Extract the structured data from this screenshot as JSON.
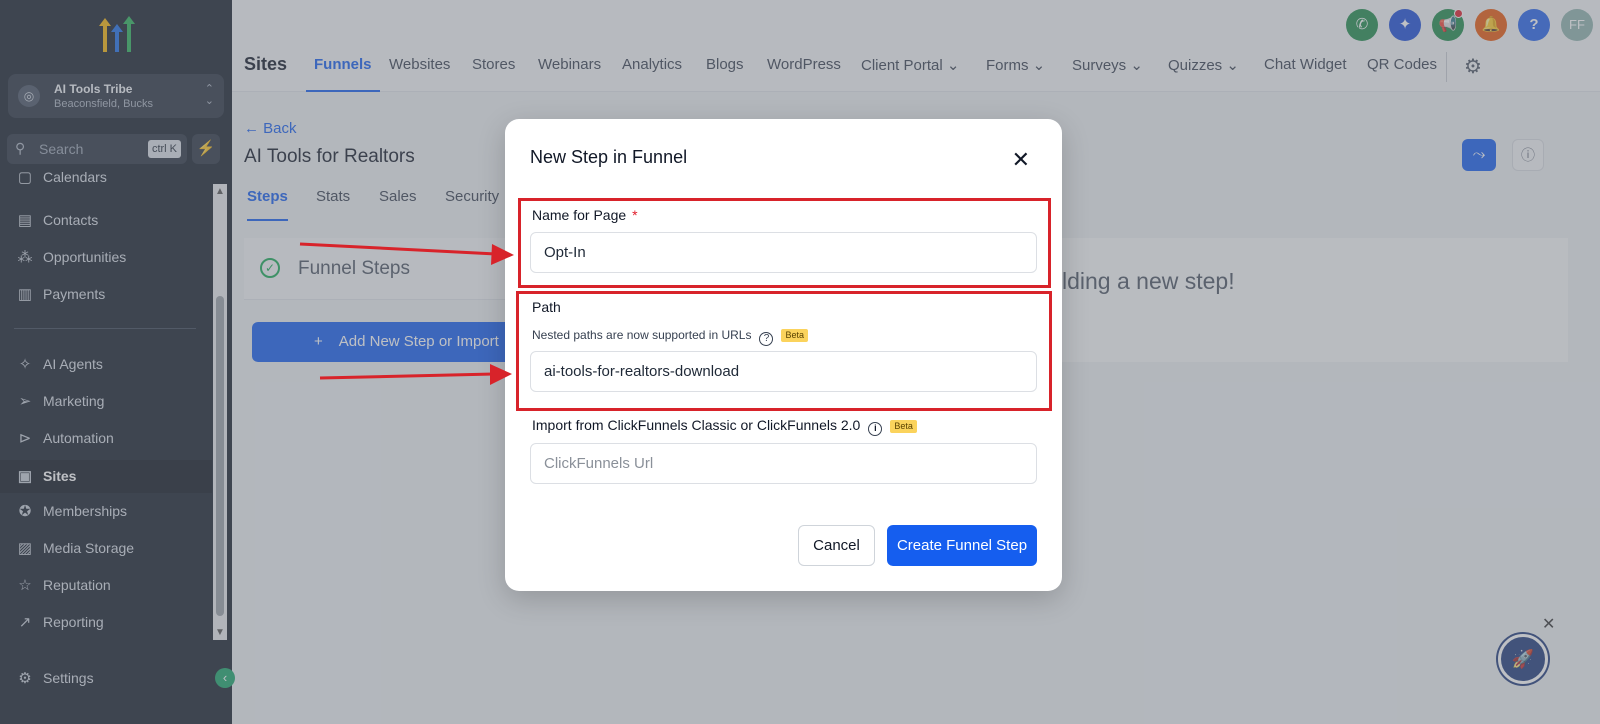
{
  "account": {
    "name": "AI Tools Tribe",
    "location": "Beaconsfield, Bucks"
  },
  "search": {
    "label": "Search",
    "shortcut": "ctrl K"
  },
  "sidebar": {
    "items": [
      {
        "label": "Calendars",
        "icon": "calendar-icon"
      },
      {
        "label": "Contacts",
        "icon": "contacts-icon"
      },
      {
        "label": "Opportunities",
        "icon": "opportunities-icon"
      },
      {
        "label": "Payments",
        "icon": "payments-icon"
      },
      {
        "label": "AI Agents",
        "icon": "sparkle-icon"
      },
      {
        "label": "Marketing",
        "icon": "send-icon"
      },
      {
        "label": "Automation",
        "icon": "play-circle-icon"
      },
      {
        "label": "Sites",
        "icon": "browser-icon"
      },
      {
        "label": "Memberships",
        "icon": "badge-icon"
      },
      {
        "label": "Media Storage",
        "icon": "image-icon"
      },
      {
        "label": "Reputation",
        "icon": "star-icon"
      },
      {
        "label": "Reporting",
        "icon": "trend-icon"
      },
      {
        "label": "Settings",
        "icon": "gear-icon"
      }
    ]
  },
  "header": {
    "title": "Sites",
    "avatar": "FF",
    "tabs": [
      "Funnels",
      "Websites",
      "Stores",
      "Webinars",
      "Analytics",
      "Blogs",
      "WordPress",
      "Client Portal",
      "Forms",
      "Surveys",
      "Quizzes",
      "Chat Widget",
      "QR Codes"
    ],
    "icon_colors": {
      "phone": "#1f8a4c",
      "sparkle": "#1d4ed8",
      "megaphone": "#1f8a4c",
      "bell": "#ea580c",
      "help": "#2563eb",
      "avatar": "#8fb3ad"
    }
  },
  "page": {
    "back": "← Back",
    "title": "AI Tools for Realtors",
    "subtabs": [
      "Steps",
      "Stats",
      "Sales",
      "Security"
    ],
    "funnel_steps_label": "Funnel Steps",
    "add_step_label": "Add New Step or Import",
    "empty_message": "lding a new step!"
  },
  "modal": {
    "title": "New Step in Funnel",
    "name_label": "Name for Page",
    "name_required": "*",
    "name_value": "Opt-In",
    "path_label": "Path",
    "path_helper": "Nested paths are now supported in URLs",
    "beta": "Beta",
    "path_value": "ai-tools-for-realtors-download",
    "import_label": "Import from ClickFunnels Classic or ClickFunnels 2.0",
    "import_placeholder": "ClickFunnels Url",
    "cancel": "Cancel",
    "create": "Create Funnel Step"
  },
  "colors": {
    "accent": "#155eef",
    "annotation": "#d8232a",
    "sidebar_bg": "#17202d"
  }
}
